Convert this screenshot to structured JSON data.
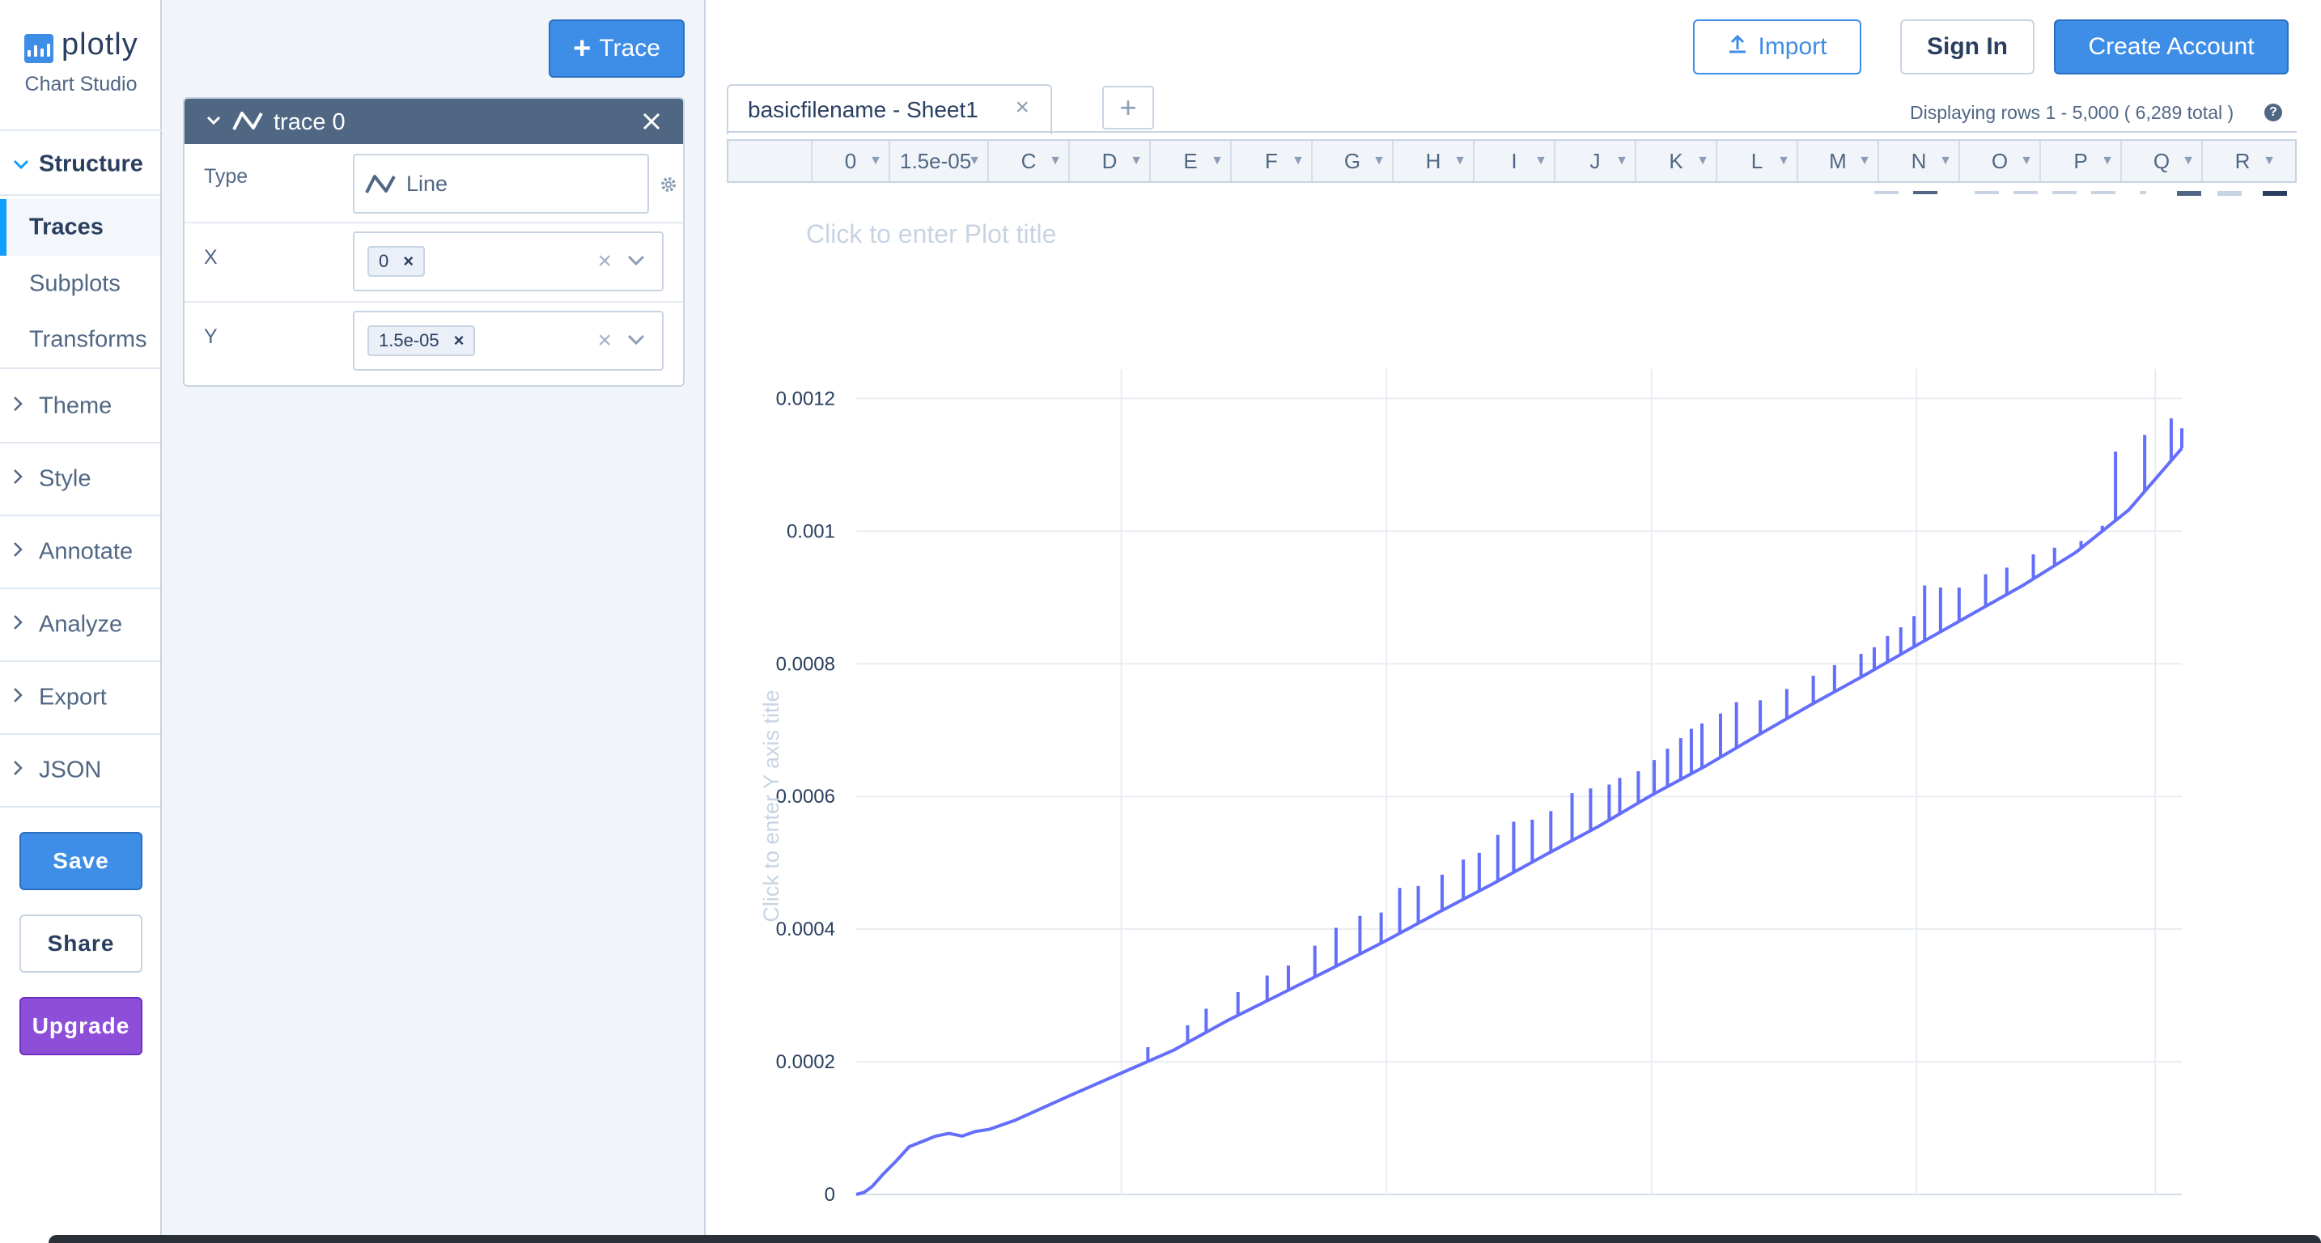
{
  "brand": {
    "name": "plotly",
    "subtitle": "Chart Studio"
  },
  "nav": {
    "structure_label": "Structure",
    "structure_items": [
      "Traces",
      "Subplots",
      "Transforms"
    ],
    "groups": [
      "Theme",
      "Style",
      "Annotate",
      "Analyze",
      "Export",
      "JSON"
    ],
    "save_label": "Save",
    "share_label": "Share",
    "upgrade_label": "Upgrade"
  },
  "panel": {
    "add_trace_label": "Trace",
    "trace": {
      "name": "trace 0",
      "type_label": "Type",
      "type_value": "Line",
      "x_label": "X",
      "x_value": "0",
      "y_label": "Y",
      "y_value": "1.5e-05"
    }
  },
  "topbar": {
    "import_label": "Import",
    "signin_label": "Sign In",
    "create_label": "Create Account"
  },
  "sheet": {
    "tab_name": "basicfilename - Sheet1",
    "add_tab": "+",
    "rows_info": "Displaying rows 1 - 5,000 ( 6,289 total )",
    "columns": [
      "0",
      "1.5e-05",
      "C",
      "D",
      "E",
      "F",
      "G",
      "H",
      "I",
      "J",
      "K",
      "L",
      "M",
      "N",
      "O",
      "P",
      "Q",
      "R"
    ]
  },
  "chart_data": {
    "type": "line",
    "title": "Click to enter Plot title",
    "ylabel": "Click to enter Y axis title",
    "xlabel": "",
    "ylim": [
      0,
      0.00122
    ],
    "yticks": [
      0,
      0.0002,
      0.0004,
      0.0006,
      0.0008,
      0.001,
      0.0012
    ],
    "ytick_labels": [
      "0",
      "0.0002",
      "0.0004",
      "0.0006",
      "0.0008",
      "0.001",
      "0.0012"
    ],
    "x_range": [
      0,
      5000
    ],
    "x_grid_positions": [
      1000,
      2000,
      3000,
      4000,
      4900
    ],
    "series": [
      {
        "x": [
          0,
          30,
          60,
          100,
          150,
          200,
          300,
          350,
          400,
          450,
          500,
          600,
          800,
          1000,
          1200,
          1400,
          1600,
          1800,
          2000,
          2200,
          2400,
          2600,
          2800,
          3000,
          3200,
          3400,
          3600,
          3800,
          4000,
          4200,
          4400,
          4600,
          4800,
          5000
        ],
        "y": [
          0,
          3e-06,
          1.2e-05,
          3e-05,
          5e-05,
          7.2e-05,
          8.8e-05,
          9.2e-05,
          8.8e-05,
          9.5e-05,
          9.8e-05,
          0.000112,
          0.000148,
          0.000183,
          0.000218,
          0.000262,
          0.000302,
          0.000342,
          0.000383,
          0.000426,
          0.000468,
          0.000512,
          0.000555,
          0.000602,
          0.000645,
          0.000692,
          0.000738,
          0.000782,
          0.000828,
          0.000873,
          0.000918,
          0.000968,
          0.001032,
          0.001125
        ]
      }
    ],
    "spikes": {
      "x": [
        1100,
        1250,
        1320,
        1440,
        1550,
        1630,
        1730,
        1810,
        1900,
        1980,
        2050,
        2120,
        2210,
        2290,
        2350,
        2420,
        2480,
        2550,
        2620,
        2700,
        2770,
        2840,
        2880,
        2950,
        3010,
        3060,
        3110,
        3150,
        3190,
        3260,
        3320,
        3410,
        3510,
        3610,
        3690,
        3790,
        3840,
        3890,
        3940,
        3990,
        4030,
        4090,
        4160,
        4260,
        4340,
        4440,
        4520,
        4620,
        4700,
        4750,
        4810,
        4860,
        4920,
        4960,
        5000
      ],
      "y": [
        0.000222,
        0.000255,
        0.00028,
        0.000305,
        0.00033,
        0.000345,
        0.000375,
        0.000402,
        0.00042,
        0.000425,
        0.000462,
        0.000465,
        0.000482,
        0.000505,
        0.000515,
        0.000542,
        0.000562,
        0.000565,
        0.000578,
        0.000605,
        0.000612,
        0.000618,
        0.000628,
        0.000638,
        0.000655,
        0.000672,
        0.000688,
        0.000702,
        0.00071,
        0.000725,
        0.000742,
        0.000745,
        0.000762,
        0.000782,
        0.000798,
        0.000815,
        0.000825,
        0.000842,
        0.000855,
        0.000872,
        0.000918,
        0.000915,
        0.000915,
        0.000935,
        0.000945,
        0.000965,
        0.000975,
        0.000985,
        0.001008,
        0.00112,
        0.001015,
        0.001145,
        0.00106,
        0.00117,
        0.001155
      ]
    }
  },
  "colors": {
    "line": "#636efa",
    "accent": "#3e8de6",
    "upgrade": "#8d4fd8",
    "panel_header": "#506784",
    "grid": "#e8edf3"
  }
}
